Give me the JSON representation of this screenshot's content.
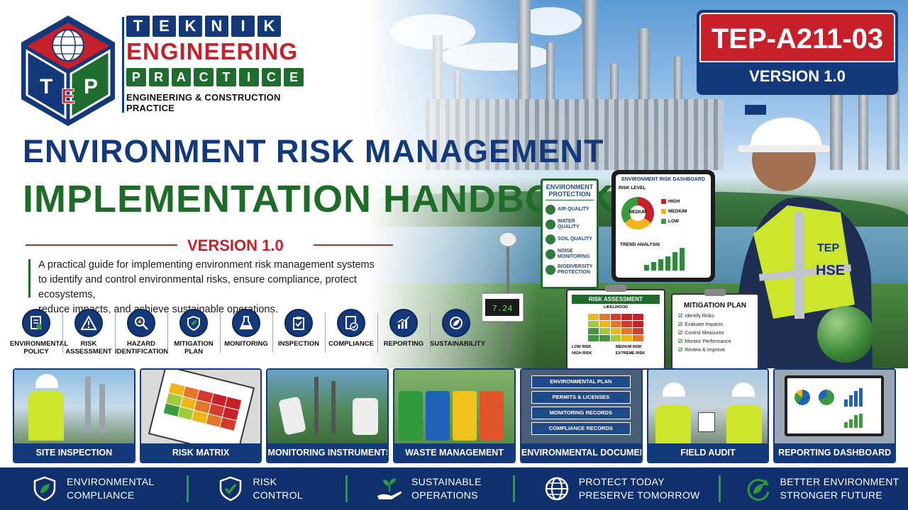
{
  "brand": {
    "logo_letters": "TEP",
    "teknik": [
      "T",
      "E",
      "K",
      "N",
      "I",
      "K"
    ],
    "engineering": "ENGINEERING",
    "practice": [
      "P",
      "R",
      "A",
      "C",
      "T",
      "I",
      "C",
      "E"
    ],
    "subtitle": "ENGINEERING & CONSTRUCTION PRACTICE"
  },
  "code_badge": {
    "code": "TEP-A211-03",
    "version": "VERSION 1.0"
  },
  "title": {
    "line1": "ENVIRONMENT RISK MANAGEMENT",
    "line2": "IMPLEMENTATION HANDBOOK",
    "version": "VERSION 1.0"
  },
  "description": {
    "line1": "A practical guide for implementing environment risk management systems",
    "line2": "to identify and control environmental risks, ensure compliance, protect ecosystems,",
    "line3": "reduce impacts, and achieve sustainable operations."
  },
  "features": [
    {
      "label": "ENVIRONMENTAL POLICY",
      "icon": "policy-icon"
    },
    {
      "label": "RISK ASSESSMENT",
      "icon": "warning-icon"
    },
    {
      "label": "HAZARD IDENTIFICATION",
      "icon": "magnifier-icon"
    },
    {
      "label": "MITIGATION PLAN",
      "icon": "shield-leaf-icon"
    },
    {
      "label": "MONITORING",
      "icon": "flask-icon"
    },
    {
      "label": "INSPECTION",
      "icon": "clipboard-icon"
    },
    {
      "label": "COMPLIANCE",
      "icon": "document-check-icon"
    },
    {
      "label": "REPORTING",
      "icon": "bar-chart-icon"
    },
    {
      "label": "SUSTAINABILITY",
      "icon": "leaf-icon"
    }
  ],
  "signboard": {
    "title": "ENVIRONMENT PROTECTION",
    "items": [
      "AIR QUALITY",
      "WATER QUALITY",
      "SOIL QUALITY",
      "NOISE MONITORING",
      "BIODIVERSITY PROTECTION"
    ]
  },
  "dashboard": {
    "title": "ENVIRONMENT RISK DASHBOARD",
    "risk_level": "RISK LEVEL",
    "center": "MEDIUM",
    "legend": [
      "HIGH",
      "MEDIUM",
      "LOW"
    ],
    "trend": "TREND ANALYSIS"
  },
  "risk_clip": {
    "title": "RISK ASSESSMENT",
    "axis": "LIKELIHOOD",
    "legend": [
      "LOW RISK",
      "MEDIUM RISK",
      "HIGH RISK",
      "EXTREME RISK"
    ]
  },
  "mitigation": {
    "title": "MITIGATION PLAN",
    "items": [
      "Identify Risks",
      "Evaluate Impacts",
      "Control Measures",
      "Monitor Performance",
      "Review & Improve"
    ]
  },
  "worker_vest": {
    "logo": "TEP",
    "text": "HSE"
  },
  "station_display": "7.24",
  "cards": [
    {
      "caption": "SITE INSPECTION"
    },
    {
      "caption": "RISK MATRIX"
    },
    {
      "caption": "MONITORING INSTRUMENTS"
    },
    {
      "caption": "WASTE MANAGEMENT"
    },
    {
      "caption": "ENVIRONMENTAL DOCUMENTATION"
    },
    {
      "caption": "FIELD AUDIT"
    },
    {
      "caption": "REPORTING DASHBOARD"
    }
  ],
  "binders": [
    "ENVIRONMENTAL PLAN",
    "PERMITS & LICENSES",
    "MONITORING RECORDS",
    "COMPLIANCE RECORDS"
  ],
  "banner": [
    {
      "line1": "ENVIRONMENTAL",
      "line2": "COMPLIANCE",
      "icon": "shield-leaf-icon"
    },
    {
      "line1": "RISK",
      "line2": "CONTROL",
      "icon": "shield-check-icon"
    },
    {
      "line1": "SUSTAINABLE",
      "line2": "OPERATIONS",
      "icon": "hand-plant-icon"
    },
    {
      "line1": "PROTECT TODAY",
      "line2": "PRESERVE TOMORROW",
      "icon": "globe-icon"
    },
    {
      "line1": "BETTER ENVIRONMENT",
      "line2": "STRONGER FUTURE",
      "icon": "recycle-leaf-icon"
    }
  ],
  "colors": {
    "navy": "#14397b",
    "red": "#c8202a",
    "green": "#1f6b2a",
    "banner": "#0f2f6d"
  }
}
